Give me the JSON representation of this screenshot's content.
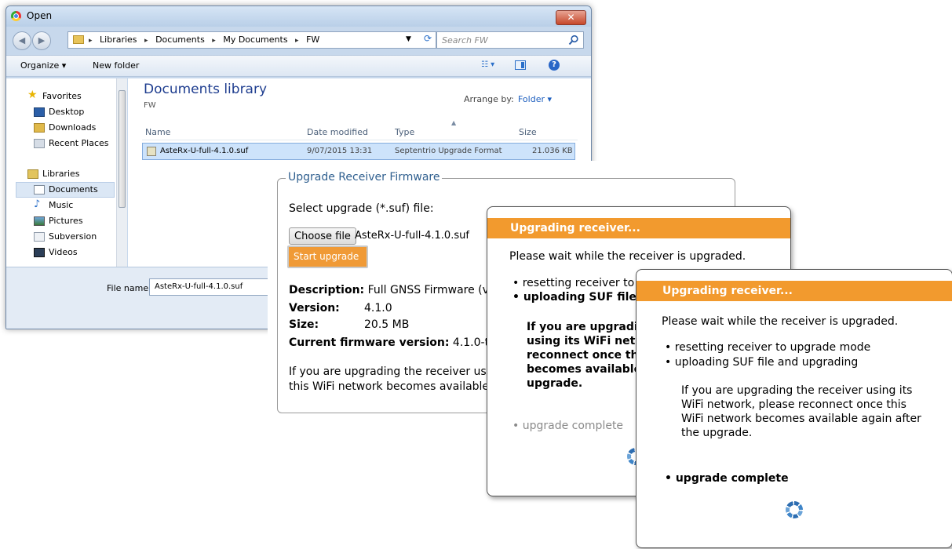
{
  "open_dialog": {
    "title": "Open",
    "close_glyph": "✕",
    "back_glyph": "◀",
    "forward_glyph": "▶",
    "breadcrumb": [
      "Libraries",
      "Documents",
      "My Documents",
      "FW"
    ],
    "crumb_separator": "▸",
    "search_placeholder": "Search FW",
    "toolbar": {
      "organize": "Organize ▾",
      "new_folder": "New folder",
      "view_glyph": "☷ ▾",
      "help_glyph": "?"
    },
    "nav": {
      "favorites": "Favorites",
      "desktop": "Desktop",
      "downloads": "Downloads",
      "recent_places": "Recent Places",
      "libraries": "Libraries",
      "documents": "Documents",
      "music": "Music",
      "pictures": "Pictures",
      "subversion": "Subversion",
      "videos": "Videos"
    },
    "library_title": "Documents library",
    "library_subtitle": "FW",
    "arrange_by_label": "Arrange by:",
    "arrange_by_value": "Folder ▾",
    "columns": {
      "name": "Name",
      "date_modified": "Date modified",
      "type": "Type",
      "size": "Size"
    },
    "files": [
      {
        "name": "AsteRx-U-full-4.1.0.suf",
        "date_modified": "9/07/2015 13:31",
        "type": "Septentrio Upgrade Format",
        "size": "21.036 KB"
      }
    ],
    "file_name_label": "File name:",
    "file_name_value": "AsteRx-U-full-4.1.0.suf"
  },
  "upgrade_panel": {
    "legend": "Upgrade Receiver Firmware",
    "select_label": "Select upgrade (*.suf) file:",
    "choose_button": "Choose file",
    "chosen_file": "AsteRx-U-full-4.1.0.suf",
    "start_button": "Start upgrade",
    "description_label": "Description:",
    "description_value": "Full GNSS Firmware (ve",
    "version_label": "Version:",
    "version_value": "4.1.0",
    "size_label": "Size:",
    "size_value": "20.5 MB",
    "current_label": "Current firmware version:",
    "current_value": "4.1.0-ts",
    "note_line1": "If you are upgrading the receiver using",
    "note_line2": "this WiFi network becomes available a"
  },
  "progress_back": {
    "title": "Upgrading receiver...",
    "wait_text": "Please wait while the receiver is upgraded.",
    "bullet_1": "resetting receiver to u",
    "bullet_2": "uploading SUF file a",
    "note_line1": "If you are upgradin",
    "note_line2": "using its WiFi netw",
    "note_line3": "reconnect once thi",
    "note_line4": "becomes available",
    "note_line5": "upgrade.",
    "bullet_3": "upgrade complete"
  },
  "progress_front": {
    "title": "Upgrading receiver...",
    "wait_text": "Please wait while the receiver is upgraded.",
    "bullet_1": "resetting receiver to upgrade mode",
    "bullet_2": "uploading SUF file and upgrading",
    "note_line1": "If you are upgrading the receiver using its",
    "note_line2": "WiFi network, please reconnect once this",
    "note_line3": "WiFi network becomes available again after",
    "note_line4": "the upgrade.",
    "bullet_3": "upgrade complete"
  },
  "colors": {
    "accent_orange": "#f29a2e",
    "link_blue": "#1e3d8f"
  }
}
